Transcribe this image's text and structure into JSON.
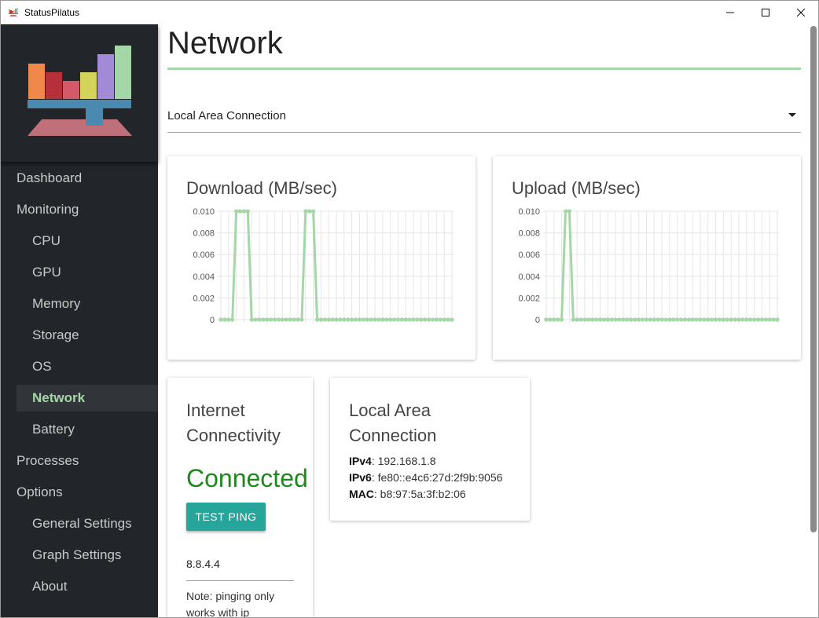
{
  "window": {
    "title": "StatusPilatus"
  },
  "sidebar": {
    "items": [
      {
        "label": "Dashboard",
        "sub": false,
        "active": false
      },
      {
        "label": "Monitoring",
        "sub": false,
        "active": false
      },
      {
        "label": "CPU",
        "sub": true,
        "active": false
      },
      {
        "label": "GPU",
        "sub": true,
        "active": false
      },
      {
        "label": "Memory",
        "sub": true,
        "active": false
      },
      {
        "label": "Storage",
        "sub": true,
        "active": false
      },
      {
        "label": "OS",
        "sub": true,
        "active": false
      },
      {
        "label": "Network",
        "sub": true,
        "active": true
      },
      {
        "label": "Battery",
        "sub": true,
        "active": false
      },
      {
        "label": "Processes",
        "sub": false,
        "active": false
      },
      {
        "label": "Options",
        "sub": false,
        "active": false
      },
      {
        "label": "General Settings",
        "sub": true,
        "active": false
      },
      {
        "label": "Graph Settings",
        "sub": true,
        "active": false
      },
      {
        "label": "About",
        "sub": true,
        "active": false
      }
    ]
  },
  "main": {
    "title": "Network",
    "adapter_select": {
      "value": "Local Area Connection"
    },
    "connectivity": {
      "title": "Internet Connectivity",
      "status": "Connected",
      "button_label": "TEST PING",
      "ip_value": "8.8.4.4",
      "note": "Note: pinging only works with ip"
    },
    "adapter_info": {
      "title": "Local Area Connection",
      "ipv4_label": "IPv4",
      "ipv4": "192.168.1.8",
      "ipv6_label": "IPv6",
      "ipv6": "fe80::e4c6:27d:2f9b:9056",
      "mac_label": "MAC",
      "mac": "b8:97:5a:3f:b2:06"
    }
  },
  "colors": {
    "accent": "#a5d6a7",
    "sidebar_bg": "#22262b",
    "connected": "#1e8a1e",
    "button": "#26a69a"
  },
  "chart_data": [
    {
      "type": "line",
      "title": "Download (MB/sec)",
      "ylim": [
        0,
        0.01
      ],
      "yticks": [
        "0.010",
        "0.008",
        "0.006",
        "0.004",
        "0.002",
        "0"
      ],
      "grid": true,
      "series": [
        {
          "values": [
            0,
            0,
            0,
            0,
            0.01,
            0.01,
            0.01,
            0.01,
            0,
            0,
            0,
            0,
            0,
            0,
            0,
            0,
            0,
            0,
            0,
            0,
            0,
            0,
            0.01,
            0.01,
            0.01,
            0,
            0,
            0,
            0,
            0,
            0,
            0,
            0,
            0,
            0,
            0,
            0,
            0,
            0,
            0,
            0,
            0,
            0,
            0,
            0,
            0,
            0,
            0,
            0,
            0,
            0,
            0,
            0,
            0,
            0,
            0,
            0,
            0,
            0,
            0,
            0
          ]
        }
      ]
    },
    {
      "type": "line",
      "title": "Upload (MB/sec)",
      "ylim": [
        0,
        0.01
      ],
      "yticks": [
        "0.010",
        "0.008",
        "0.006",
        "0.004",
        "0.002",
        "0"
      ],
      "grid": true,
      "series": [
        {
          "values": [
            0,
            0,
            0,
            0,
            0,
            0.01,
            0.01,
            0,
            0,
            0,
            0,
            0,
            0,
            0,
            0,
            0,
            0,
            0,
            0,
            0,
            0,
            0,
            0,
            0,
            0,
            0,
            0,
            0,
            0,
            0,
            0,
            0,
            0,
            0,
            0,
            0,
            0,
            0,
            0,
            0,
            0,
            0,
            0,
            0,
            0,
            0,
            0,
            0,
            0,
            0,
            0,
            0,
            0,
            0,
            0,
            0,
            0,
            0,
            0,
            0,
            0
          ]
        }
      ]
    }
  ]
}
